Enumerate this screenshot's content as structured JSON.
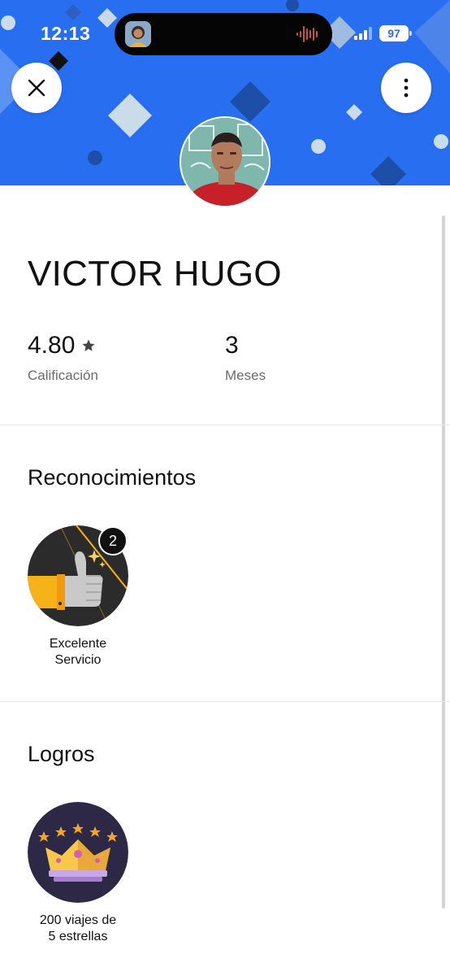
{
  "status_bar": {
    "time": "12:13",
    "battery": "97",
    "icons": [
      "island-avatar-icon",
      "audio-wave-icon",
      "signal-icon",
      "battery-icon"
    ]
  },
  "header": {
    "background_color": "#276ef1",
    "close_icon": "close-icon",
    "more_icon": "more-vertical-icon"
  },
  "profile": {
    "name": "VICTOR HUGO",
    "rating": "4.80",
    "rating_icon": "star-icon",
    "rating_label": "Calificación",
    "months": "3",
    "months_label": "Meses"
  },
  "recognitions": {
    "title": "Reconocimientos",
    "items": [
      {
        "label": "Excelente\nServicio",
        "count": "2",
        "icon": "thumbs-up-icon"
      }
    ]
  },
  "achievements": {
    "title": "Logros",
    "items": [
      {
        "label": "200 viajes de\n5 estrellas",
        "icon": "crown-icon"
      }
    ]
  },
  "colors": {
    "accent": "#276ef1",
    "badge_dark": "#2b2b2b",
    "badge_yellow": "#f6b219",
    "achievement_bg": "#2d2845"
  }
}
